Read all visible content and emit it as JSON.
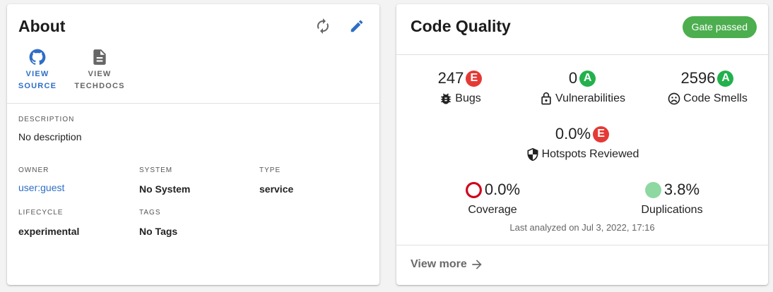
{
  "about": {
    "title": "About",
    "links": [
      {
        "label": "VIEW\nSOURCE",
        "icon": "github-icon",
        "color": "#2e6ec6"
      },
      {
        "label": "VIEW\nTECHDOCS",
        "icon": "document-icon",
        "color": "#666666"
      }
    ],
    "description_label": "DESCRIPTION",
    "description": "No description",
    "fields": {
      "owner_label": "OWNER",
      "owner": "user:guest",
      "system_label": "SYSTEM",
      "system": "No System",
      "type_label": "TYPE",
      "type": "service",
      "lifecycle_label": "LIFECYCLE",
      "lifecycle": "experimental",
      "tags_label": "TAGS",
      "tags": "No Tags"
    },
    "accent_color": "#2e6ec6"
  },
  "quality": {
    "title": "Code Quality",
    "gate_label": "Gate passed",
    "gate_color": "#4cae4f",
    "bugs": {
      "value": "247",
      "rating": "E",
      "label": "Bugs"
    },
    "vulnerabilities": {
      "value": "0",
      "rating": "A",
      "label": "Vulnerabilities"
    },
    "code_smells": {
      "value": "2596",
      "rating": "A",
      "label": "Code Smells"
    },
    "hotspots": {
      "value": "0.0%",
      "rating": "E",
      "label": "Hotspots Reviewed"
    },
    "coverage": {
      "value": "0.0%",
      "label": "Coverage"
    },
    "duplications": {
      "value": "3.8%",
      "label": "Duplications"
    },
    "last_analyzed": "Last analyzed on Jul 3, 2022, 17:16",
    "view_more": "View more",
    "rating_colors": {
      "E": "#e53935",
      "A": "#22b14c"
    },
    "coverage_color": "#d0021b",
    "duplications_color": "#8ed8a2"
  }
}
